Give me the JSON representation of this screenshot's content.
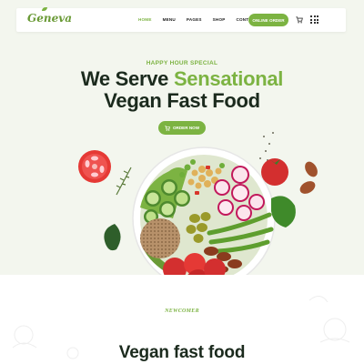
{
  "brand": {
    "logo_text": "Geneva",
    "accent": "#7cb342",
    "dark": "#1b2a1d"
  },
  "nav": {
    "items": [
      {
        "label": "HOME",
        "active": true
      },
      {
        "label": "MENU"
      },
      {
        "label": "PAGES"
      },
      {
        "label": "SHOP"
      },
      {
        "label": "CONTACT"
      }
    ],
    "order_button": "ONLINE ORDER"
  },
  "hero": {
    "eyebrow": "HAPPY HOUR SPECIAL",
    "title_part1": "We Serve ",
    "title_highlight": "Sensational",
    "title_line2": "Vegan Fast Food",
    "cta": "ORDER NOW",
    "background": "#f3f6ee"
  },
  "section": {
    "eyebrow": "NEWCOMER",
    "title": "Vegan fast food"
  },
  "icons": [
    "cart-icon",
    "grid-menu-icon",
    "leaf-icon"
  ]
}
